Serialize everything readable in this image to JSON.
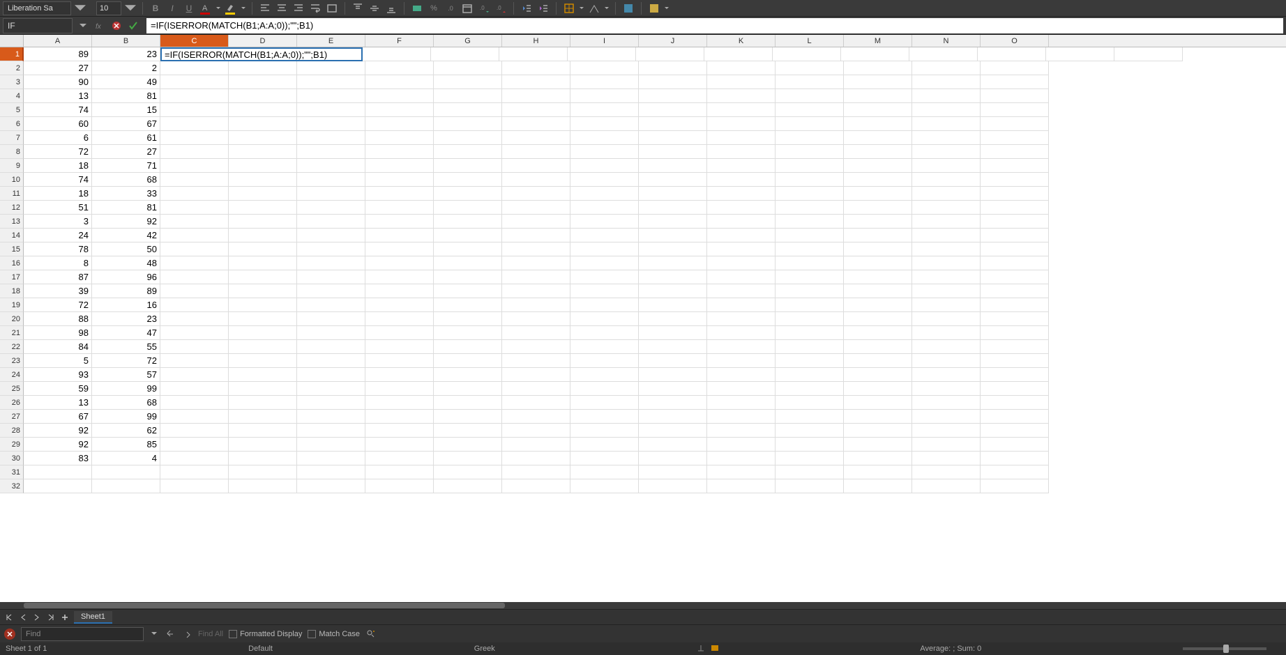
{
  "toolbar": {
    "font_name": "Liberation Sa",
    "font_size": "10",
    "bold": "B",
    "italic": "I",
    "underline": "U"
  },
  "formula_bar": {
    "name_box": "IF",
    "input": "=IF(ISERROR(MATCH(B1;A:A;0));\"\";B1)"
  },
  "columns": [
    "A",
    "B",
    "C",
    "D",
    "E",
    "F",
    "G",
    "H",
    "I",
    "J",
    "K",
    "L",
    "M",
    "N",
    "O"
  ],
  "active_col_index": 2,
  "active_row_index": 0,
  "editing_cell_text": "=IF(ISERROR(MATCH(B1;A:A;0));\"\";B1)",
  "rows": [
    {
      "n": "1",
      "a": "89",
      "b": "23"
    },
    {
      "n": "2",
      "a": "27",
      "b": "2"
    },
    {
      "n": "3",
      "a": "90",
      "b": "49"
    },
    {
      "n": "4",
      "a": "13",
      "b": "81"
    },
    {
      "n": "5",
      "a": "74",
      "b": "15"
    },
    {
      "n": "6",
      "a": "60",
      "b": "67"
    },
    {
      "n": "7",
      "a": "6",
      "b": "61"
    },
    {
      "n": "8",
      "a": "72",
      "b": "27"
    },
    {
      "n": "9",
      "a": "18",
      "b": "71"
    },
    {
      "n": "10",
      "a": "74",
      "b": "68"
    },
    {
      "n": "11",
      "a": "18",
      "b": "33"
    },
    {
      "n": "12",
      "a": "51",
      "b": "81"
    },
    {
      "n": "13",
      "a": "3",
      "b": "92"
    },
    {
      "n": "14",
      "a": "24",
      "b": "42"
    },
    {
      "n": "15",
      "a": "78",
      "b": "50"
    },
    {
      "n": "16",
      "a": "8",
      "b": "48"
    },
    {
      "n": "17",
      "a": "87",
      "b": "96"
    },
    {
      "n": "18",
      "a": "39",
      "b": "89"
    },
    {
      "n": "19",
      "a": "72",
      "b": "16"
    },
    {
      "n": "20",
      "a": "88",
      "b": "23"
    },
    {
      "n": "21",
      "a": "98",
      "b": "47"
    },
    {
      "n": "22",
      "a": "84",
      "b": "55"
    },
    {
      "n": "23",
      "a": "5",
      "b": "72"
    },
    {
      "n": "24",
      "a": "93",
      "b": "57"
    },
    {
      "n": "25",
      "a": "59",
      "b": "99"
    },
    {
      "n": "26",
      "a": "13",
      "b": "68"
    },
    {
      "n": "27",
      "a": "67",
      "b": "99"
    },
    {
      "n": "28",
      "a": "92",
      "b": "62"
    },
    {
      "n": "29",
      "a": "92",
      "b": "85"
    },
    {
      "n": "30",
      "a": "83",
      "b": "4"
    },
    {
      "n": "31",
      "a": "",
      "b": ""
    },
    {
      "n": "32",
      "a": "",
      "b": ""
    }
  ],
  "sheet_tabs": {
    "active": "Sheet1"
  },
  "find_bar": {
    "placeholder": "Find",
    "find_all": "Find All",
    "formatted_display": "Formatted Display",
    "match_case": "Match Case"
  },
  "status": {
    "sheet_info": "Sheet 1 of 1",
    "style": "Default",
    "lang": "Greek",
    "summary": "Average: ; Sum: 0"
  }
}
